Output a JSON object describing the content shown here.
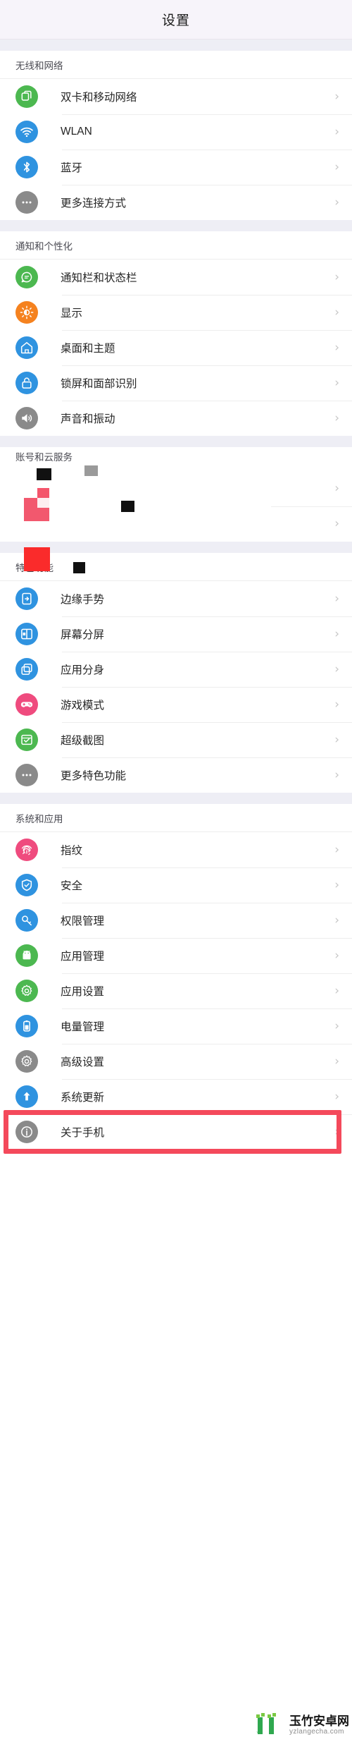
{
  "header": {
    "title": "设置"
  },
  "sections": [
    {
      "label": "无线和网络",
      "items": [
        {
          "label": "双卡和移动网络",
          "icon": "sim-card-icon",
          "color": "#4cb850"
        },
        {
          "label": "WLAN",
          "icon": "wifi-icon",
          "color": "#2f93e0"
        },
        {
          "label": "蓝牙",
          "icon": "bluetooth-icon",
          "color": "#2f93e0"
        },
        {
          "label": "更多连接方式",
          "icon": "more-dots-icon",
          "color": "#8a8a8a"
        }
      ]
    },
    {
      "label": "通知和个性化",
      "items": [
        {
          "label": "通知栏和状态栏",
          "icon": "chat-bubble-icon",
          "color": "#4cb850"
        },
        {
          "label": "显示",
          "icon": "brightness-icon",
          "color": "#f5821f"
        },
        {
          "label": "桌面和主题",
          "icon": "home-icon",
          "color": "#2f93e0"
        },
        {
          "label": "锁屏和面部识别",
          "icon": "lock-icon",
          "color": "#2f93e0"
        },
        {
          "label": "声音和振动",
          "icon": "speaker-icon",
          "color": "#8a8a8a"
        }
      ]
    },
    {
      "label": "账号和云服务",
      "glitched": true,
      "items": [
        {
          "label": "",
          "icon": "corrupted-icon",
          "color": "#f4495b"
        },
        {
          "label": "",
          "icon": "corrupted-icon",
          "color": "#fa2b2b"
        }
      ]
    },
    {
      "label": "特色功能",
      "items": [
        {
          "label": "边缘手势",
          "icon": "edge-gesture-icon",
          "color": "#2f93e0"
        },
        {
          "label": "屏幕分屏",
          "icon": "split-screen-icon",
          "color": "#2f93e0"
        },
        {
          "label": "应用分身",
          "icon": "app-clone-icon",
          "color": "#2f93e0"
        },
        {
          "label": "游戏模式",
          "icon": "gamepad-icon",
          "color": "#ef4b7e"
        },
        {
          "label": "超级截图",
          "icon": "screenshot-icon",
          "color": "#4cb850"
        },
        {
          "label": "更多特色功能",
          "icon": "more-dots-icon",
          "color": "#8a8a8a"
        }
      ]
    },
    {
      "label": "系统和应用",
      "items": [
        {
          "label": "指纹",
          "icon": "fingerprint-icon",
          "color": "#ef4b7e"
        },
        {
          "label": "安全",
          "icon": "shield-icon",
          "color": "#2f93e0"
        },
        {
          "label": "权限管理",
          "icon": "key-icon",
          "color": "#2f93e0"
        },
        {
          "label": "应用管理",
          "icon": "android-icon",
          "color": "#4cb850"
        },
        {
          "label": "应用设置",
          "icon": "gear-icon",
          "color": "#4cb850"
        },
        {
          "label": "电量管理",
          "icon": "battery-icon",
          "color": "#2f93e0"
        },
        {
          "label": "高级设置",
          "icon": "gear-icon",
          "color": "#8a8a8a"
        },
        {
          "label": "系统更新",
          "icon": "update-arrow-icon",
          "color": "#2f93e0"
        },
        {
          "label": "关于手机",
          "icon": "info-icon",
          "color": "#8a8a8a"
        }
      ]
    }
  ],
  "chevron": "›",
  "highlight": {
    "color": "#f4495b",
    "target": "关于手机"
  },
  "watermark": {
    "cn": "玉竹安卓网",
    "en": "yzlangecha.com",
    "bar_color": "#2fa84f"
  }
}
